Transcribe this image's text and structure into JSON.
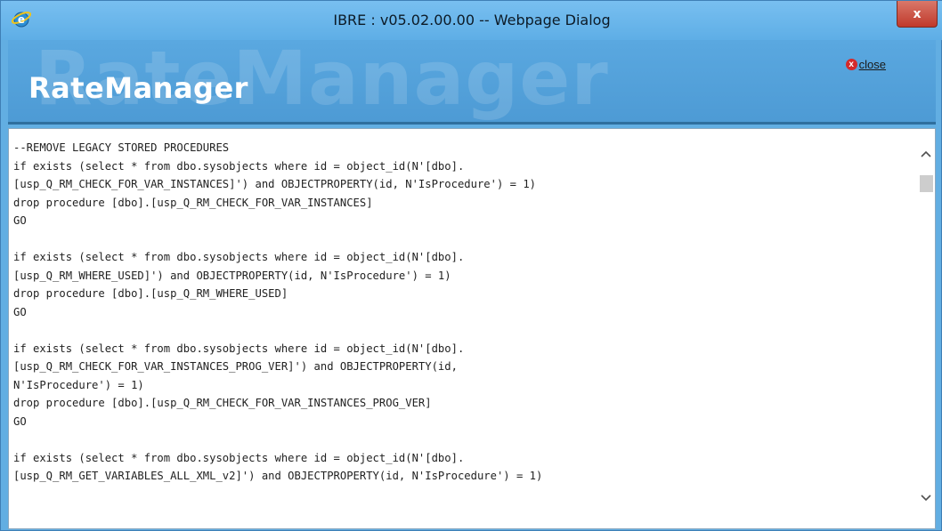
{
  "window": {
    "title": "IBRE : v05.02.00.00 -- Webpage Dialog",
    "close_glyph": "x"
  },
  "banner": {
    "logo": "RateManager",
    "watermark": "RateManager",
    "close_label": "close",
    "close_icon_glyph": "x"
  },
  "code_lines": [
    "--REMOVE LEGACY STORED PROCEDURES",
    "if exists (select * from dbo.sysobjects where id = object_id(N'[dbo].",
    "[usp_Q_RM_CHECK_FOR_VAR_INSTANCES]') and OBJECTPROPERTY(id, N'IsProcedure') = 1)",
    "drop procedure [dbo].[usp_Q_RM_CHECK_FOR_VAR_INSTANCES]",
    "GO",
    "",
    "if exists (select * from dbo.sysobjects where id = object_id(N'[dbo].",
    "[usp_Q_RM_WHERE_USED]') and OBJECTPROPERTY(id, N'IsProcedure') = 1)",
    "drop procedure [dbo].[usp_Q_RM_WHERE_USED]",
    "GO",
    "",
    "if exists (select * from dbo.sysobjects where id = object_id(N'[dbo].",
    "[usp_Q_RM_CHECK_FOR_VAR_INSTANCES_PROG_VER]') and OBJECTPROPERTY(id,",
    "N'IsProcedure') = 1)",
    "drop procedure [dbo].[usp_Q_RM_CHECK_FOR_VAR_INSTANCES_PROG_VER]",
    "GO",
    "",
    "if exists (select * from dbo.sysobjects where id = object_id(N'[dbo].",
    "[usp_Q_RM_GET_VARIABLES_ALL_XML_v2]') and OBJECTPROPERTY(id, N'IsProcedure') = 1)"
  ],
  "scrollbar": {
    "up_glyph": "^",
    "down_glyph": "v"
  },
  "icons": {
    "app": "ie-icon",
    "window_close": "close-icon",
    "banner_close": "close-circle-icon"
  },
  "colors": {
    "frame": "#62aee2",
    "window_close": "#c0392b",
    "banner_close_dot": "#d42a2a"
  }
}
